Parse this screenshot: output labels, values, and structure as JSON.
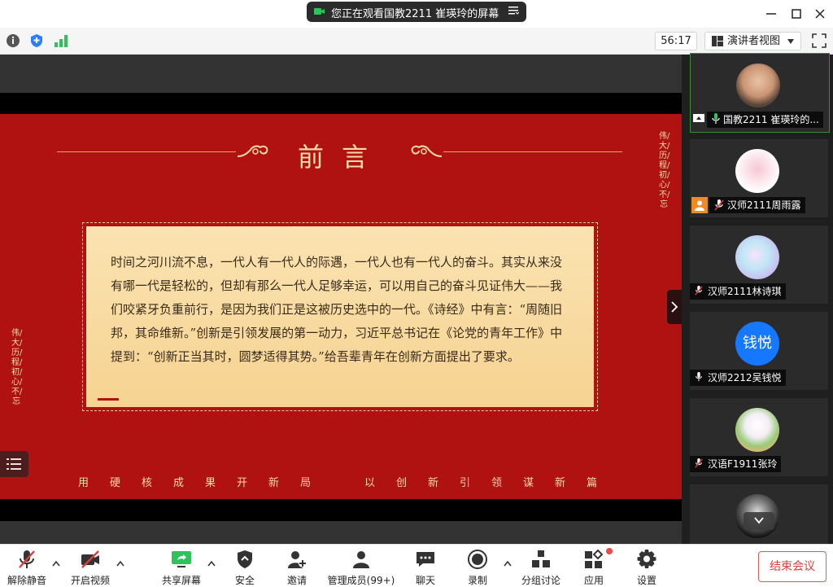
{
  "window": {
    "share_banner": "您正在观看国教2211 崔瑛玲的屏幕"
  },
  "toolbar": {
    "timer": "56:17",
    "view_label": "演讲者视图"
  },
  "slide": {
    "title": "前言",
    "body": "时间之河川流不息，一代人有一代人的际遇，一代人也有一代人的奋斗。其实从来没有哪一代是轻松的，但却有那么一代人足够幸运，可以用自己的奋斗见证伟大——我们咬紧牙负重前行，是因为我们正是这被历史选中的一代。《诗经》中有言：“周随旧邦，其命维新。”创新是引领发展的第一动力，习近平总书记在《论党的青年工作》中提到：“创新正当其时，圆梦适得其势。”给吾辈青年在创新方面提出了要求。",
    "vertical_right": "伟/大/历/程/初/心/不/忘",
    "vertical_left": "伟/大/历/程/初/心/不/忘",
    "slogan_left": "用硬核成果开新局",
    "slogan_right": "以创新引领谋新篇",
    "colors": {
      "bg": "#b01212",
      "gold": "#f4dca8",
      "card": "#f8dca3"
    }
  },
  "participants": [
    {
      "name": "国教2211 崔瑛玲的...",
      "sharing": true
    },
    {
      "name": "汉师2111周雨露",
      "muted": true
    },
    {
      "name": "汉师2111林诗琪",
      "muted": true
    },
    {
      "name": "汉师2212吴钱悦",
      "muted": false,
      "initials": "钱悦"
    },
    {
      "name": "汉语F1911张玲",
      "muted": true
    },
    {
      "name": ""
    }
  ],
  "bottom": {
    "unmute": "解除静音",
    "start_video": "开启视频",
    "share_screen": "共享屏幕",
    "security": "安全",
    "invite": "邀请",
    "members": "管理成员(99+)",
    "chat": "聊天",
    "record": "录制",
    "breakout": "分组讨论",
    "apps": "应用",
    "settings": "设置",
    "end_meeting": "结束会议"
  }
}
